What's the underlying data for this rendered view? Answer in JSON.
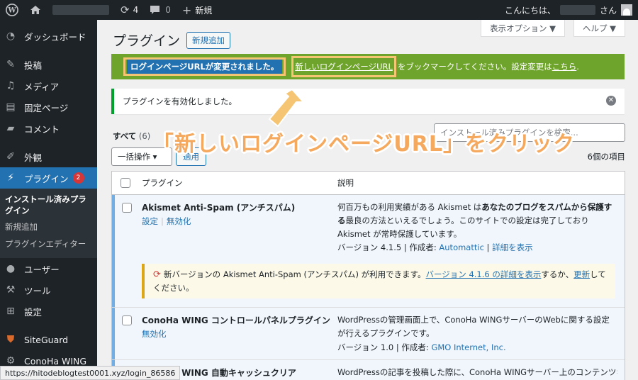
{
  "adminbar": {
    "updates_count": "4",
    "comments_count": "0",
    "new_label": "新規",
    "greeting": "こんにちは、",
    "greeting_suffix": "さん"
  },
  "sidebar": {
    "items": [
      {
        "label": "ダッシュボード",
        "icon": "dashboard-icon"
      },
      {
        "label": "投稿",
        "icon": "pin-icon"
      },
      {
        "label": "メディア",
        "icon": "media-icon"
      },
      {
        "label": "固定ページ",
        "icon": "page-icon"
      },
      {
        "label": "コメント",
        "icon": "comment-icon"
      },
      {
        "label": "外観",
        "icon": "appearance-icon"
      },
      {
        "label": "プラグイン",
        "icon": "plugin-icon",
        "badge": "2"
      },
      {
        "label": "ユーザー",
        "icon": "user-icon"
      },
      {
        "label": "ツール",
        "icon": "wrench-icon"
      },
      {
        "label": "設定",
        "icon": "settings-icon"
      },
      {
        "label": "SiteGuard",
        "icon": "siteguard-icon"
      },
      {
        "label": "ConoHa WING",
        "icon": "conoha-icon"
      }
    ],
    "submenu": [
      "インストール済みプラグイン",
      "新規追加",
      "プラグインエディター"
    ]
  },
  "header": {
    "screen_options": "表示オプション ▼",
    "help": "ヘルプ ▼",
    "title": "プラグイン",
    "add_new": "新規追加"
  },
  "notices": {
    "login_changed": "ログインページURLが変更されました。",
    "new_login_url_link": "新しいログインページURL",
    "bookmark_text": "をブックマークしてください。設定変更は",
    "here_link": "こちら",
    "period": ".",
    "activated": "プラグインを有効化しました。"
  },
  "caption": "「新しいログインページURL」をクリック",
  "filters": {
    "all_label": "すべて",
    "all_count": "(6)",
    "search_placeholder": "インストール済みプラグインを検索..."
  },
  "bulk": {
    "select_label": "一括操作 ▾",
    "apply": "適用",
    "item_count": "6個の項目"
  },
  "table": {
    "col_plugin": "プラグイン",
    "col_desc": "説明",
    "rows": [
      {
        "name": "Akismet Anti-Spam (アンチスパム)",
        "action1": "設定",
        "action2": "無効化",
        "desc_pre": "何百万もの利用実績がある Akismet は",
        "desc_bold": "あなたのブログをスパムから保護する",
        "desc_post": "最良の方法といえるでしょう。このサイトでの設定は完了しており Akismet が常時保護しています。",
        "version_label": "バージョン 4.1.5",
        "author_label": "作成者:",
        "author": "Automattic",
        "details": "詳細を表示",
        "update_pre": "新バージョンの Akismet Anti-Spam (アンチスパム) が利用できます。",
        "update_link": "バージョン 4.1.6 の詳細を表示",
        "update_mid": "するか、",
        "update_link2": "更新",
        "update_post": "してください。"
      },
      {
        "name": "ConoHa WING コントロールパネルプラグイン",
        "action1": "無効化",
        "desc": "WordPressの管理画面上で、ConoHa WINGサーバーのWebに関する設定が行えるプラグインです。",
        "version_label": "バージョン 1.0",
        "author_label": "作成者:",
        "author": "GMO Internet, Inc."
      },
      {
        "name": "ConoHa WING 自動キャッシュクリア",
        "desc": "WordPressの記事を投稿した際に、ConoHa WINGサーバー上のコンテンツキ"
      }
    ]
  },
  "status_url": "https://hitodeblogtest0001.xyz/login_86586"
}
